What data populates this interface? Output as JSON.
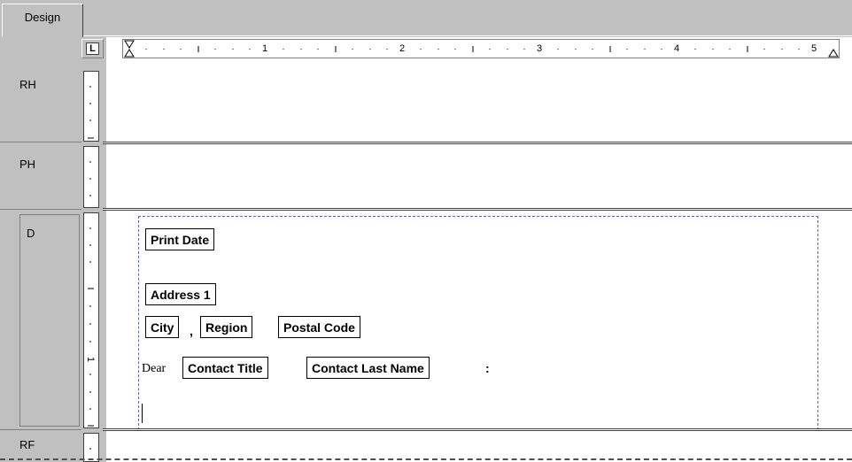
{
  "tabs": [
    {
      "label": "Design"
    }
  ],
  "corner_label": "L",
  "ruler": {
    "numbers": [
      "1",
      "2",
      "3",
      "4",
      "5"
    ]
  },
  "sections": {
    "rh": "RH",
    "ph": "PH",
    "d": "D",
    "rf": "RF"
  },
  "detail": {
    "print_date": "Print Date",
    "address": "Address 1",
    "city": "City",
    "comma": ",",
    "region": "Region",
    "postal_code": "Postal Code",
    "dear": "Dear",
    "contact_title": "Contact Title",
    "contact_last_name": "Contact Last Name",
    "colon": ":"
  },
  "colors": {
    "canvas": "#ffffff",
    "chrome": "#c0c0c0",
    "selection": "#5a6aa0"
  }
}
